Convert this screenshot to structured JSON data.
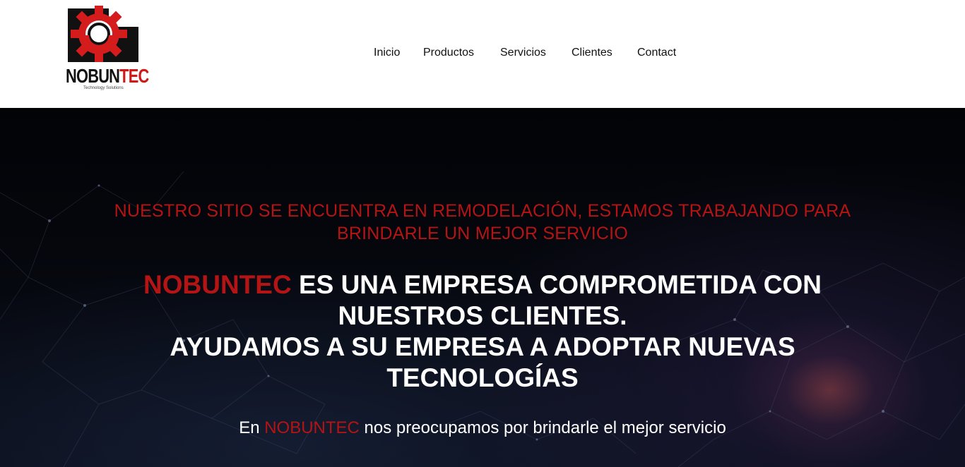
{
  "logo": {
    "word_part1": "NOBUN",
    "word_part2": "TEC",
    "tagline": "Technology Solutions"
  },
  "nav": {
    "items": [
      {
        "label": "Inicio"
      },
      {
        "label": "Productos"
      },
      {
        "label": "Servicios"
      },
      {
        "label": "Clientes"
      },
      {
        "label": "Contact"
      }
    ]
  },
  "hero": {
    "notice_line1": "NUESTRO SITIO SE ENCUENTRA EN REMODELACIÓN, ESTAMOS TRABAJANDO PARA",
    "notice_line2": "BRINDARLE UN MEJOR SERVICIO",
    "headline_brand": "NOBUNTEC",
    "headline_rest1": " ES UNA EMPRESA COMPROMETIDA CON",
    "headline_line2": "NUESTROS CLIENTES.",
    "headline_line3": "AYUDAMOS A SU EMPRESA A ADOPTAR NUEVAS",
    "headline_line4": "TECNOLOGÍAS",
    "sub_prefix": "En ",
    "sub_brand": "NOBUNTEC",
    "sub_suffix": " nos preocupamos por brindarle el mejor servicio"
  },
  "colors": {
    "brand_red": "#b51414",
    "hero_background": "#05070d",
    "header_background": "#ffffff"
  }
}
